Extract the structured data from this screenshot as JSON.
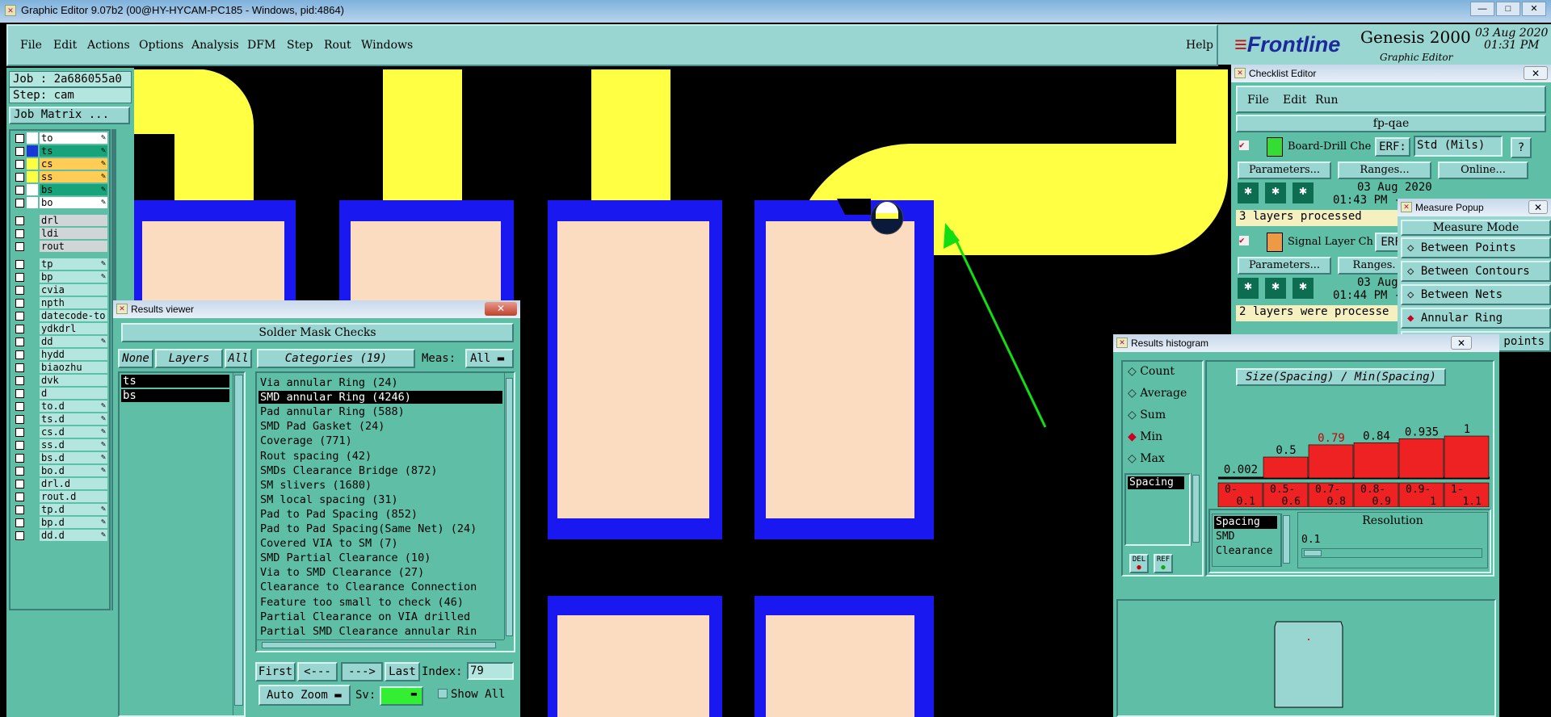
{
  "window": {
    "title": "Graphic Editor 9.07b2 (00@HY-HYCAM-PC185 - Windows, pid:4864)",
    "controls": [
      "—",
      "□",
      "✕"
    ]
  },
  "menu": {
    "items": [
      "File",
      "Edit",
      "Actions",
      "Options",
      "Analysis",
      "DFM",
      "Step",
      "Rout",
      "Windows"
    ],
    "help": "Help"
  },
  "brand": {
    "logo": "Frontline",
    "product": "Genesis 2000",
    "subtitle": "Graphic Editor",
    "date": "03 Aug 2020",
    "time": "01:31 PM"
  },
  "job": {
    "job_label": "Job : 2a686055a0",
    "step_label": "Step: cam",
    "matrix_button": "Job Matrix ..."
  },
  "layers": [
    {
      "name": "to",
      "color": "#ffffff",
      "hl": "#ffffff",
      "icon": true
    },
    {
      "name": "ts",
      "color": "#1a38d6",
      "hl": "#19a37a",
      "icon": true
    },
    {
      "name": "cs",
      "color": "#ffff44",
      "hl": "#ffcc55",
      "icon": true
    },
    {
      "name": "ss",
      "color": "#ffff44",
      "hl": "#ffcc55",
      "icon": true
    },
    {
      "name": "bs",
      "color": "#ffffff",
      "hl": "#19a37a",
      "icon": true
    },
    {
      "name": "bo",
      "color": "#ffffff",
      "hl": "#ffffff",
      "icon": true
    },
    {
      "name": "drl",
      "color": "",
      "hl": "#cfd6d5",
      "icon": false
    },
    {
      "name": "ldi",
      "color": "",
      "hl": "#cfd6d5",
      "icon": false
    },
    {
      "name": "rout",
      "color": "",
      "hl": "#cfd6d5",
      "icon": false
    },
    {
      "name": "tp",
      "color": "",
      "hl": "",
      "icon": true
    },
    {
      "name": "bp",
      "color": "",
      "hl": "",
      "icon": true
    },
    {
      "name": "cvia",
      "color": "",
      "hl": "",
      "icon": false
    },
    {
      "name": "npth",
      "color": "",
      "hl": "",
      "icon": false
    },
    {
      "name": "datecode-to",
      "color": "",
      "hl": "",
      "icon": false
    },
    {
      "name": "ydkdrl",
      "color": "",
      "hl": "",
      "icon": false
    },
    {
      "name": "dd",
      "color": "",
      "hl": "",
      "icon": true
    },
    {
      "name": "hydd",
      "color": "",
      "hl": "",
      "icon": false
    },
    {
      "name": "biaozhu",
      "color": "",
      "hl": "",
      "icon": false
    },
    {
      "name": "dvk",
      "color": "",
      "hl": "",
      "icon": false
    },
    {
      "name": "d",
      "color": "",
      "hl": "",
      "icon": false
    },
    {
      "name": "to.d",
      "color": "",
      "hl": "",
      "icon": true
    },
    {
      "name": "ts.d",
      "color": "",
      "hl": "",
      "icon": true
    },
    {
      "name": "cs.d",
      "color": "",
      "hl": "",
      "icon": true
    },
    {
      "name": "ss.d",
      "color": "",
      "hl": "",
      "icon": true
    },
    {
      "name": "bs.d",
      "color": "",
      "hl": "",
      "icon": true
    },
    {
      "name": "bo.d",
      "color": "",
      "hl": "",
      "icon": true
    },
    {
      "name": "drl.d",
      "color": "",
      "hl": "",
      "icon": false
    },
    {
      "name": "rout.d",
      "color": "",
      "hl": "",
      "icon": false
    },
    {
      "name": "tp.d",
      "color": "",
      "hl": "",
      "icon": true
    },
    {
      "name": "bp.d",
      "color": "",
      "hl": "",
      "icon": true
    },
    {
      "name": "dd.d",
      "color": "",
      "hl": "",
      "icon": true
    }
  ],
  "results_viewer": {
    "title": "Results viewer",
    "header": "Solder Mask Checks",
    "none_btn": "None",
    "layers_btn": "Layers",
    "all_btn": "All",
    "categories_btn": "Categories (19)",
    "meas_label": "Meas:",
    "meas_value": "All",
    "layer_list": [
      "ts",
      "bs"
    ],
    "categories": [
      "Via annular Ring (24)",
      "SMD annular Ring (4246)",
      "Pad annular Ring (588)",
      "SMD Pad Gasket (24)",
      "Coverage (771)",
      "Rout spacing (42)",
      "SMDs Clearance Bridge (872)",
      "SM slivers (1680)",
      "SM local spacing (31)",
      "Pad to Pad Spacing (852)",
      "Pad to Pad Spacing(Same Net) (24)",
      "Covered VIA to SM (7)",
      "SMD Partial Clearance (10)",
      "Via to SMD Clearance (27)",
      "Clearance to Clearance Connection",
      "Feature too small to check (46)",
      "Partial Clearance on VIA drilled",
      "Partial SMD Clearance annular Rin"
    ],
    "selected_index": 1,
    "first_btn": "First",
    "prev_btn": "<---",
    "next_btn": "--->",
    "last_btn": "Last",
    "index_label": "Index:",
    "index_value": "79",
    "autozoom_btn": "Auto Zoom",
    "sv_label": "Sv:",
    "show_all": "Show All"
  },
  "checklist": {
    "title": "Checklist Editor",
    "menu": [
      "File",
      "Edit",
      "Run"
    ],
    "name": "fp-qae",
    "items": [
      {
        "name": "Board-Drill Che",
        "erf": "ERF:",
        "erf_value": "Std (Mils)",
        "help": "?",
        "params": "Parameters...",
        "ranges": "Ranges...",
        "online": "Online...",
        "date": "03 Aug 2020",
        "time": "01:43 PM -",
        "status": "3 layers processed"
      },
      {
        "name": "Signal Layer Ch",
        "erf": "ERF",
        "params": "Parameters...",
        "ranges": "Ranges.",
        "date": "03 Aug",
        "time": "01:44 PM -",
        "status": "2 layers were processe"
      }
    ]
  },
  "measure": {
    "title": "Measure Popup",
    "header": "Measure Mode",
    "options": [
      "Between Points",
      "Between Contours",
      "Between Nets",
      "Annular Ring"
    ],
    "selected": "Annular Ring",
    "partial": "points"
  },
  "histogram": {
    "title": "Results histogram",
    "modes": [
      "Count",
      "Average",
      "Sum",
      "Min",
      "Max"
    ],
    "selected_mode": "Min",
    "chart_title": "Size(Spacing) / Min(Spacing)",
    "del_btn": "DEL",
    "ref_btn": "REF",
    "left_list": [
      "Spacing"
    ],
    "type_list": [
      "Spacing",
      "SMD",
      "Clearance"
    ],
    "resolution_label": "Resolution",
    "resolution_value": "0.1"
  },
  "chart_data": {
    "type": "bar",
    "title": "Size(Spacing) / Min(Spacing)",
    "categories": [
      "0-0.1",
      "0.5-0.6",
      "0.7-0.8",
      "0.8-0.9",
      "0.9-1",
      "1-1.1"
    ],
    "values": [
      0.002,
      0.5,
      0.79,
      0.84,
      0.935,
      1
    ],
    "value_labels": [
      "0.002",
      "0.5",
      "0.79",
      "0.84",
      "0.935",
      "1"
    ],
    "highlight_index": 2,
    "bar_color": "#ee2222",
    "ylim": [
      0,
      1
    ]
  },
  "colors": {
    "pad": "#fcdcc0",
    "trace": "#ffff44",
    "mask": "#1a18f0",
    "panel": "#5fbfa6",
    "arrow": "#11dd11"
  }
}
